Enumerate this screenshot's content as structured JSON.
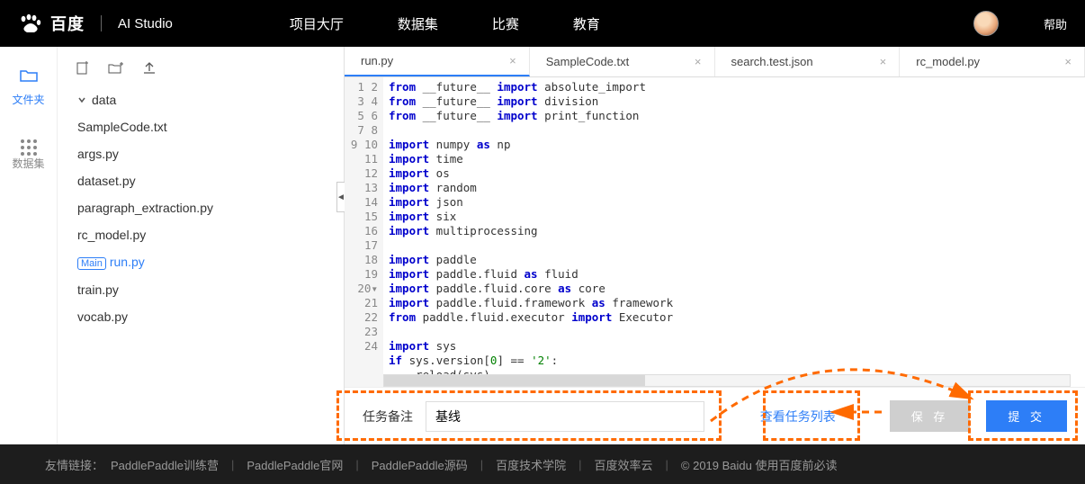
{
  "header": {
    "logo_text": "百度",
    "logo_sub": "AI Studio",
    "nav": [
      "项目大厅",
      "数据集",
      "比赛",
      "教育"
    ],
    "help": "帮助"
  },
  "rail": {
    "files": "文件夹",
    "datasets": "数据集"
  },
  "tree": {
    "folder": "data",
    "files": [
      "SampleCode.txt",
      "args.py",
      "dataset.py",
      "paragraph_extraction.py",
      "rc_model.py",
      "run.py",
      "train.py",
      "vocab.py"
    ],
    "main_badge": "Main",
    "active": "run.py"
  },
  "tabs": [
    {
      "name": "run.py",
      "active": true
    },
    {
      "name": "SampleCode.txt",
      "active": false
    },
    {
      "name": "search.test.json",
      "active": false
    },
    {
      "name": "rc_model.py",
      "active": false
    }
  ],
  "code_lines": 24,
  "bottom": {
    "label": "任务备注",
    "input_value": "基线",
    "view_link": "查看任务列表",
    "save": "保 存",
    "submit": "提 交"
  },
  "footer": {
    "label": "友情链接：",
    "links": [
      "PaddlePaddle训练营",
      "PaddlePaddle官网",
      "PaddlePaddle源码",
      "百度技术学院",
      "百度效率云"
    ],
    "copyright": "© 2019 Baidu 使用百度前必读"
  }
}
